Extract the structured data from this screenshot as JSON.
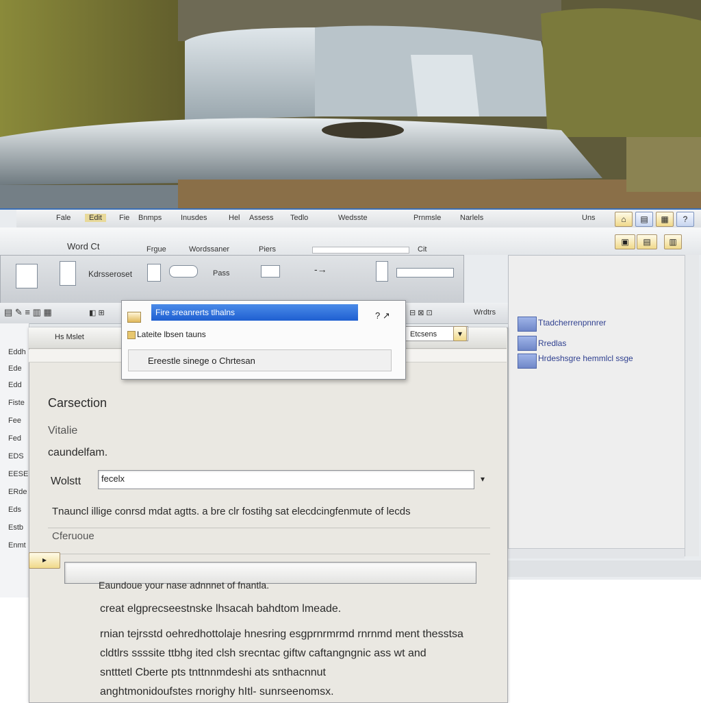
{
  "menubar": {
    "items": [
      "Fale",
      "Edit",
      "Fie",
      "Bnmps",
      "Inusdes",
      "Hel",
      "Assess",
      "Tedlo",
      "Wedsste",
      "Prnmsle",
      "Narlels"
    ],
    "right_label": "Uns"
  },
  "quickbar": {
    "app_title": "Word Ct",
    "tabs": [
      "Frgue",
      "Wordssaner",
      "Piers"
    ],
    "field_label": "Cit"
  },
  "ribbon": {
    "labels": [
      "Kdrsseroset",
      "Pass"
    ]
  },
  "ribbon2": {
    "right_label": "Wrdtrs",
    "combo_label": "Etcsens",
    "left_label": "Hs Mslet"
  },
  "rightpane": {
    "links": [
      "Ttadcherrenpnnrer",
      "Rredlas",
      "Hrdeshsgre hemmlcl ssge"
    ]
  },
  "sidebar": {
    "items": [
      "Eddh",
      "Ede",
      "Edd",
      "Fiste",
      "Fee",
      "Fed",
      "EDS",
      "EESE",
      "ERde",
      "Eds",
      "Estb",
      "Enmt"
    ]
  },
  "dropdown": {
    "selected": "Fire sreanrerts tlhalns",
    "items": [
      "Lateite lbsen tauns"
    ],
    "field_value": "Ereestle sinege o Chrtesan"
  },
  "dialog": {
    "heading": "Carsection",
    "sub1": "Vitalie",
    "sub2": "caundelfam.",
    "input_label": "Wolstt",
    "input_value": "fecelx",
    "description": "Tnauncl illige conrsd mdat agtts. a bre clr fostihg sat elecdcingfenmute of lecds",
    "section_label": "Cferuoue",
    "caption": "Eaundoue your nase adnnnet of fnantla.",
    "para1": "creat elgprecseestnske lhsacah bahdtom lmeade.",
    "para2_lines": [
      "rnian tejrsstd oehredhottolaje hnesring esgprnrmrmd rnrnmd ment thesstsa",
      "cldtlrs ssssite ttbhg ited clsh srecntac giftw caftangngnic ass wt and",
      "sntttetl Cberte pts tnttnnmdeshi ats snthacnnut",
      "anghtmonidoufstes rnorighy hItl- sunrseenomsx."
    ]
  },
  "colors": {
    "selection": "#1f5fd1",
    "link": "#2e3f8f",
    "window_border": "#3b6fb6"
  }
}
